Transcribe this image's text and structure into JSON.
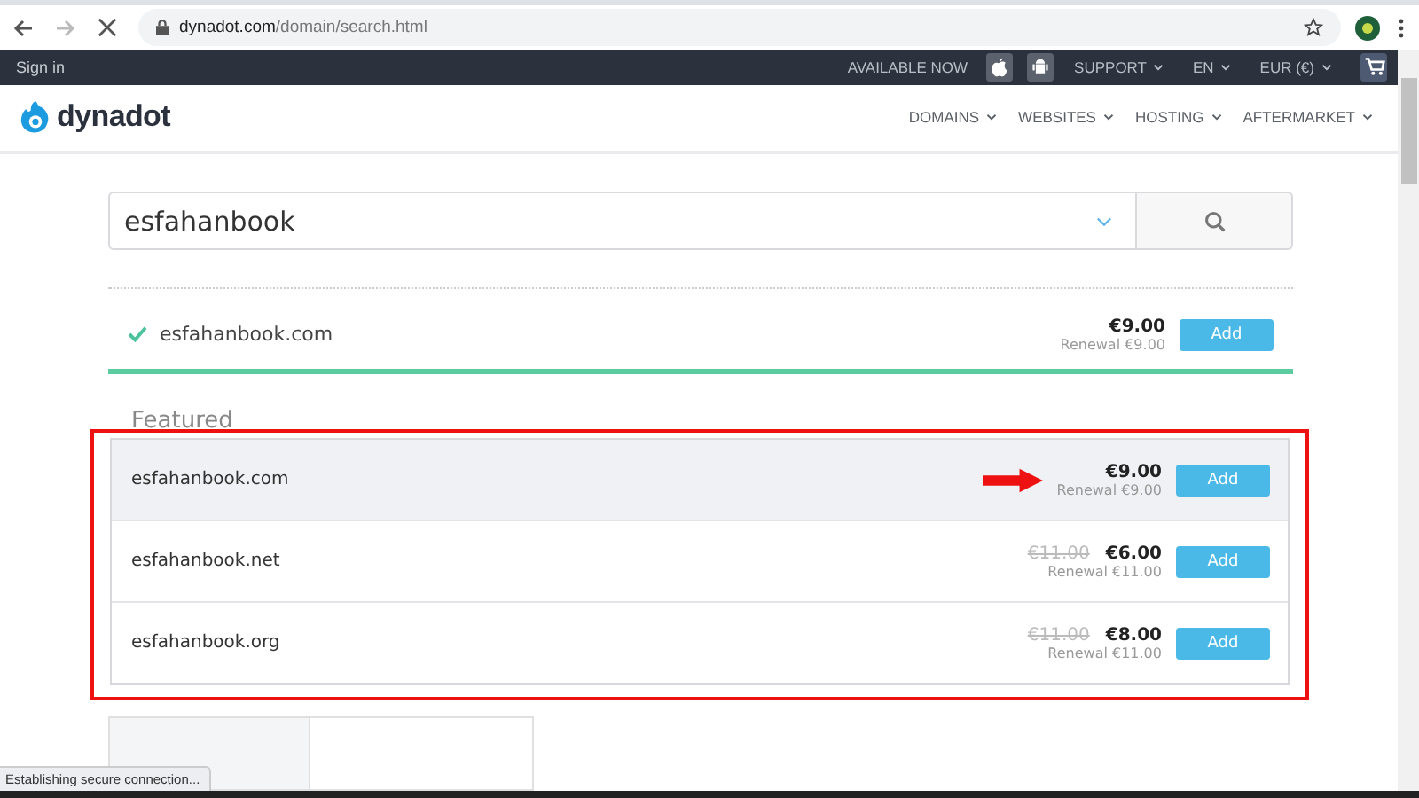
{
  "browser": {
    "url_host": "dynadot.com",
    "url_path": "/domain/search.html"
  },
  "topbar": {
    "sign_in": "Sign in",
    "available": "AVAILABLE NOW",
    "menus": [
      "SUPPORT",
      "EN",
      "EUR (€)"
    ]
  },
  "nav": {
    "brand": "dynadot",
    "items": [
      "DOMAINS",
      "WEBSITES",
      "HOSTING",
      "AFTERMARKET"
    ]
  },
  "search": {
    "value": "esfahanbook"
  },
  "result": {
    "domain": "esfahanbook.com",
    "available": true,
    "price": "€9.00",
    "renewal": "Renewal €9.00",
    "button": "Add"
  },
  "featured": {
    "title": "Featured",
    "outlined": true,
    "rows": [
      {
        "domain": "esfahanbook.com",
        "price": "€9.00",
        "renewal": "Renewal €9.00",
        "button": "Add",
        "highlighted": true,
        "arrow": true
      },
      {
        "domain": "esfahanbook.net",
        "old_price": "€11.00",
        "price": "€6.00",
        "renewal": "Renewal €11.00",
        "button": "Add",
        "highlighted": false,
        "arrow": false
      },
      {
        "domain": "esfahanbook.org",
        "old_price": "€11.00",
        "price": "€8.00",
        "renewal": "Renewal €11.00",
        "button": "Add",
        "highlighted": false,
        "arrow": false
      }
    ]
  },
  "status_bar": "Establishing secure connection..."
}
